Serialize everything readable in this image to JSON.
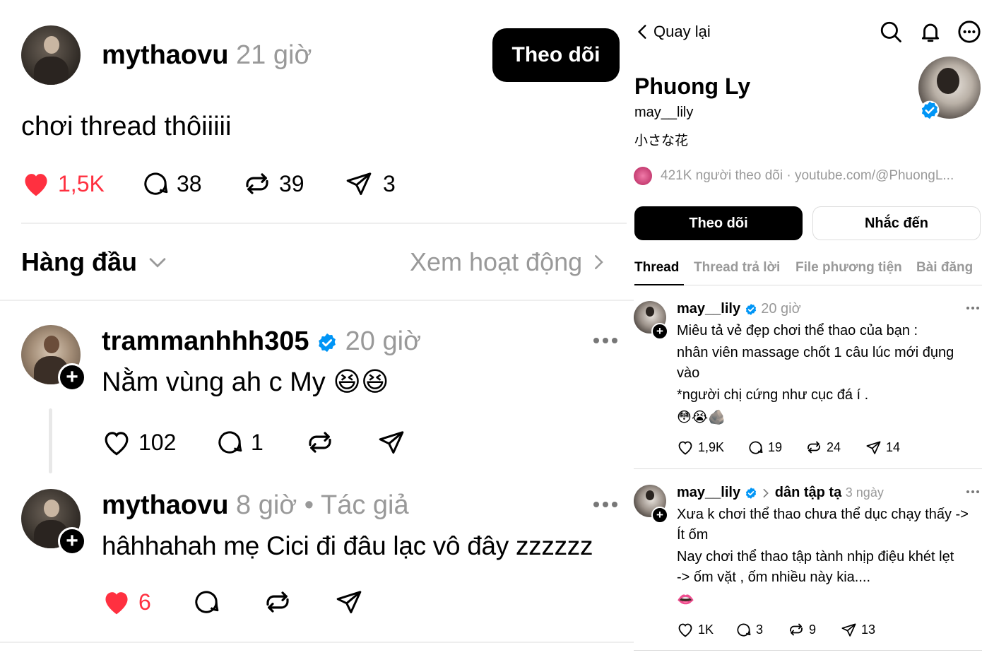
{
  "left": {
    "post": {
      "username": "mythaovu",
      "time": "21 giờ",
      "follow_label": "Theo dõi",
      "text": "chơi thread thôiiiii",
      "likes": "1,5K",
      "comments": "38",
      "reposts": "39",
      "shares": "3"
    },
    "sort_label": "Hàng đầu",
    "activity_label": "Xem hoạt động",
    "replies": [
      {
        "username": "trammanhhh305",
        "time": "20 giờ",
        "text": "Nằm vùng ah c My",
        "emoji": "😆😆",
        "likes": "102",
        "comments": "1"
      },
      {
        "username": "mythaovu",
        "time": "8 giờ",
        "separator": "•",
        "author_tag": "Tác giả",
        "text": "hâhhahah mẹ Cici đi đâu lạc vô đây zzzzzz",
        "likes": "6"
      }
    ]
  },
  "right": {
    "back_label": "Quay lại",
    "profile": {
      "name": "Phuong Ly",
      "handle": "may__lily",
      "bio": "小さな花",
      "followers": "421K người theo dõi · youtube.com/@PhuongL...",
      "follow_label": "Theo dõi",
      "mention_label": "Nhắc đến"
    },
    "tabs": [
      "Thread",
      "Thread trả lời",
      "File phương tiện",
      "Bài đăng"
    ],
    "posts": [
      {
        "username": "may__lily",
        "time": "20 giờ",
        "lines": [
          "Miêu tả vẻ đẹp chơi thể thao của bạn :",
          "nhân viên massage chốt 1 câu lúc mới đụng",
          "vào",
          "*người chị cứng như cục đá í ."
        ],
        "emoji": "😳😭🪨",
        "likes": "1,9K",
        "comments": "19",
        "reposts": "24",
        "shares": "14"
      },
      {
        "username": "may__lily",
        "community": "dân tập tạ",
        "time": "3 ngày",
        "lines": [
          "Xưa k chơi thể thao chưa thể dục chạy thấy ->",
          "Ít ốm",
          "Nay chơi thể thao tập tành nhịp điệu khét lẹt",
          "-> ốm vặt , ốm nhiều này kia...."
        ],
        "emoji": "👄",
        "likes": "1K",
        "comments": "3",
        "reposts": "9",
        "shares": "13"
      }
    ]
  },
  "colors": {
    "like_red": "#ff3040",
    "verified_blue": "#0095f6",
    "gray_text": "#999999"
  }
}
